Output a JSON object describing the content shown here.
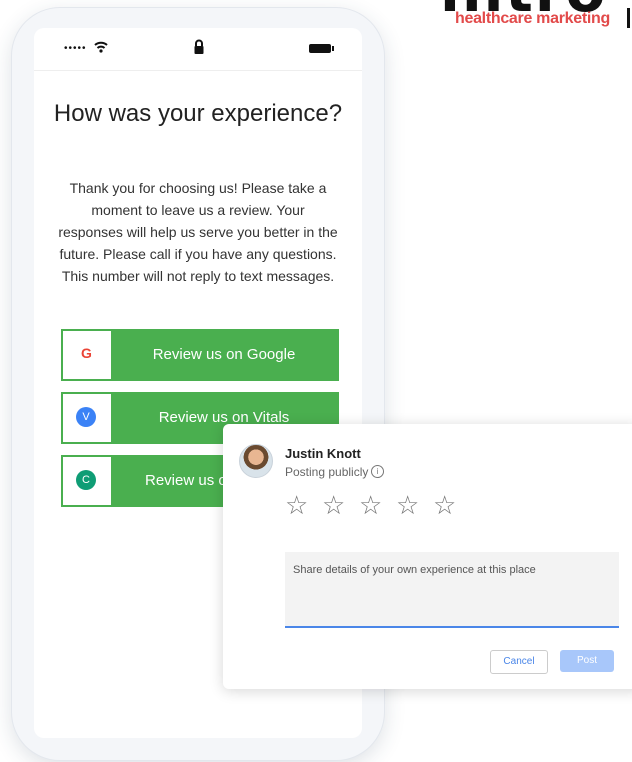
{
  "brand": {
    "wordmark": "intro",
    "tagline": "healthcare marketing"
  },
  "phone": {
    "status": {
      "signal": "•••••"
    },
    "headline": "How was your experience?",
    "body": "Thank you for choosing us! Please take a moment to leave us a review. Your responses will help us serve you better in the future. Please call if you have any questions. This number will not reply to text messages.",
    "buttons": [
      {
        "label": "Review us on Google",
        "icon": "G"
      },
      {
        "label": "Review us on Vitals",
        "icon": "V"
      },
      {
        "label": "Review us on",
        "icon": "C"
      }
    ]
  },
  "review_card": {
    "user_name": "Justin Knott",
    "posting_status": "Posting publicly",
    "info_glyph": "i",
    "star_glyph": "☆",
    "rating": 0,
    "placeholder": "Share details of your own experience at this place",
    "cancel_label": "Cancel",
    "post_label": "Post"
  },
  "colors": {
    "button_green": "#4aaf4f",
    "brand_red": "#e24a4a",
    "accent_blue": "#4a86e8",
    "vitals_blue": "#3b82f6",
    "third_icon_teal": "#0f9d75"
  }
}
